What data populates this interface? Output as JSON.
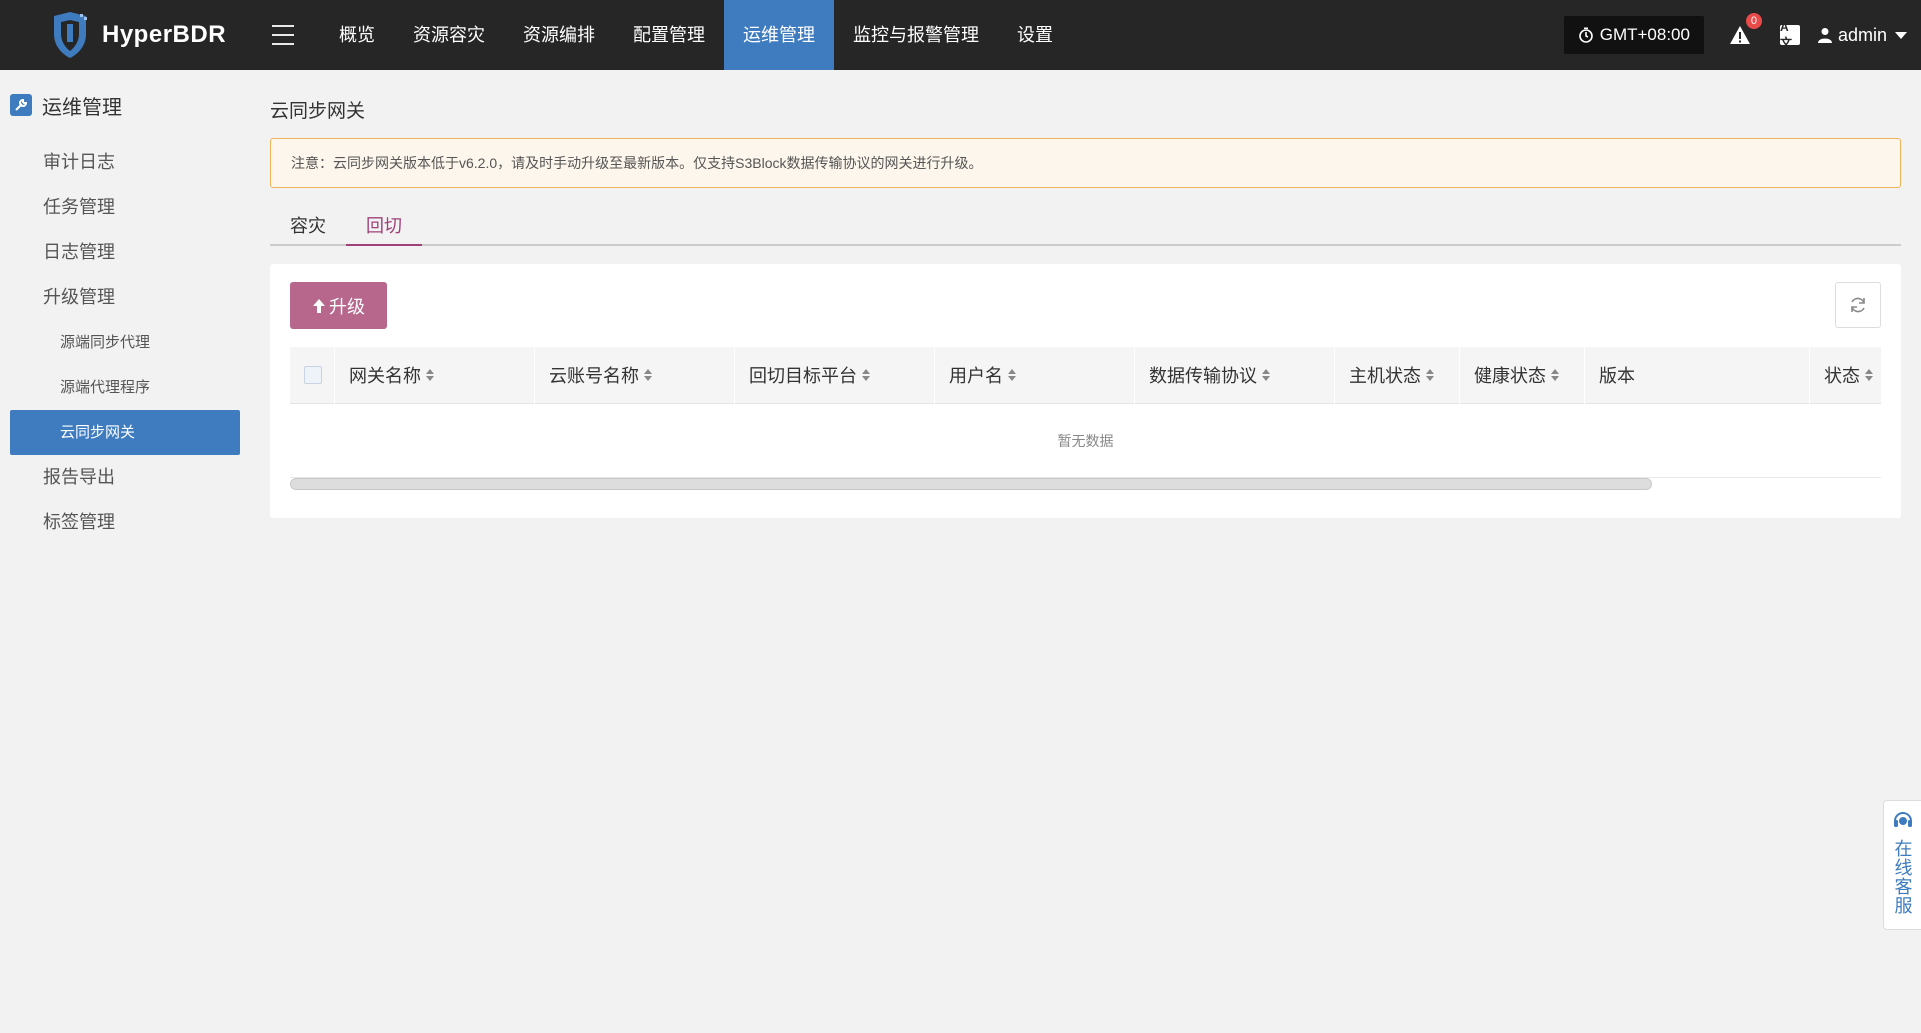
{
  "app": {
    "name": "HyperBDR"
  },
  "nav": {
    "items": [
      "概览",
      "资源容灾",
      "资源编排",
      "配置管理",
      "运维管理",
      "监控与报警管理",
      "设置"
    ],
    "active_index": 4
  },
  "header": {
    "timezone": "GMT+08:00",
    "alert_count": "0",
    "lang_label": "A文",
    "user": "admin"
  },
  "sidebar": {
    "title": "运维管理",
    "items": [
      {
        "label": "审计日志",
        "level": 1
      },
      {
        "label": "任务管理",
        "level": 1
      },
      {
        "label": "日志管理",
        "level": 1
      },
      {
        "label": "升级管理",
        "level": 1
      },
      {
        "label": "源端同步代理",
        "level": 2
      },
      {
        "label": "源端代理程序",
        "level": 2
      },
      {
        "label": "云同步网关",
        "level": 2,
        "active": true
      },
      {
        "label": "报告导出",
        "level": 1
      },
      {
        "label": "标签管理",
        "level": 1
      }
    ]
  },
  "page": {
    "title": "云同步网关",
    "notice": "注意：云同步网关版本低于v6.2.0，请及时手动升级至最新版本。仅支持S3Block数据传输协议的网关进行升级。",
    "tabs": [
      "容灾",
      "回切"
    ],
    "active_tab": 1,
    "upgrade_label": "升级",
    "table": {
      "columns": [
        "网关名称",
        "云账号名称",
        "回切目标平台",
        "用户名",
        "数据传输协议",
        "主机状态",
        "健康状态",
        "版本",
        "状态"
      ],
      "empty_text": "暂无数据"
    }
  },
  "online_service": "在线客服",
  "colors": {
    "topbar": "#262626",
    "accent": "#3e7cbf",
    "upgrade_button": "#b7668c",
    "active_tab": "#a0417a"
  }
}
